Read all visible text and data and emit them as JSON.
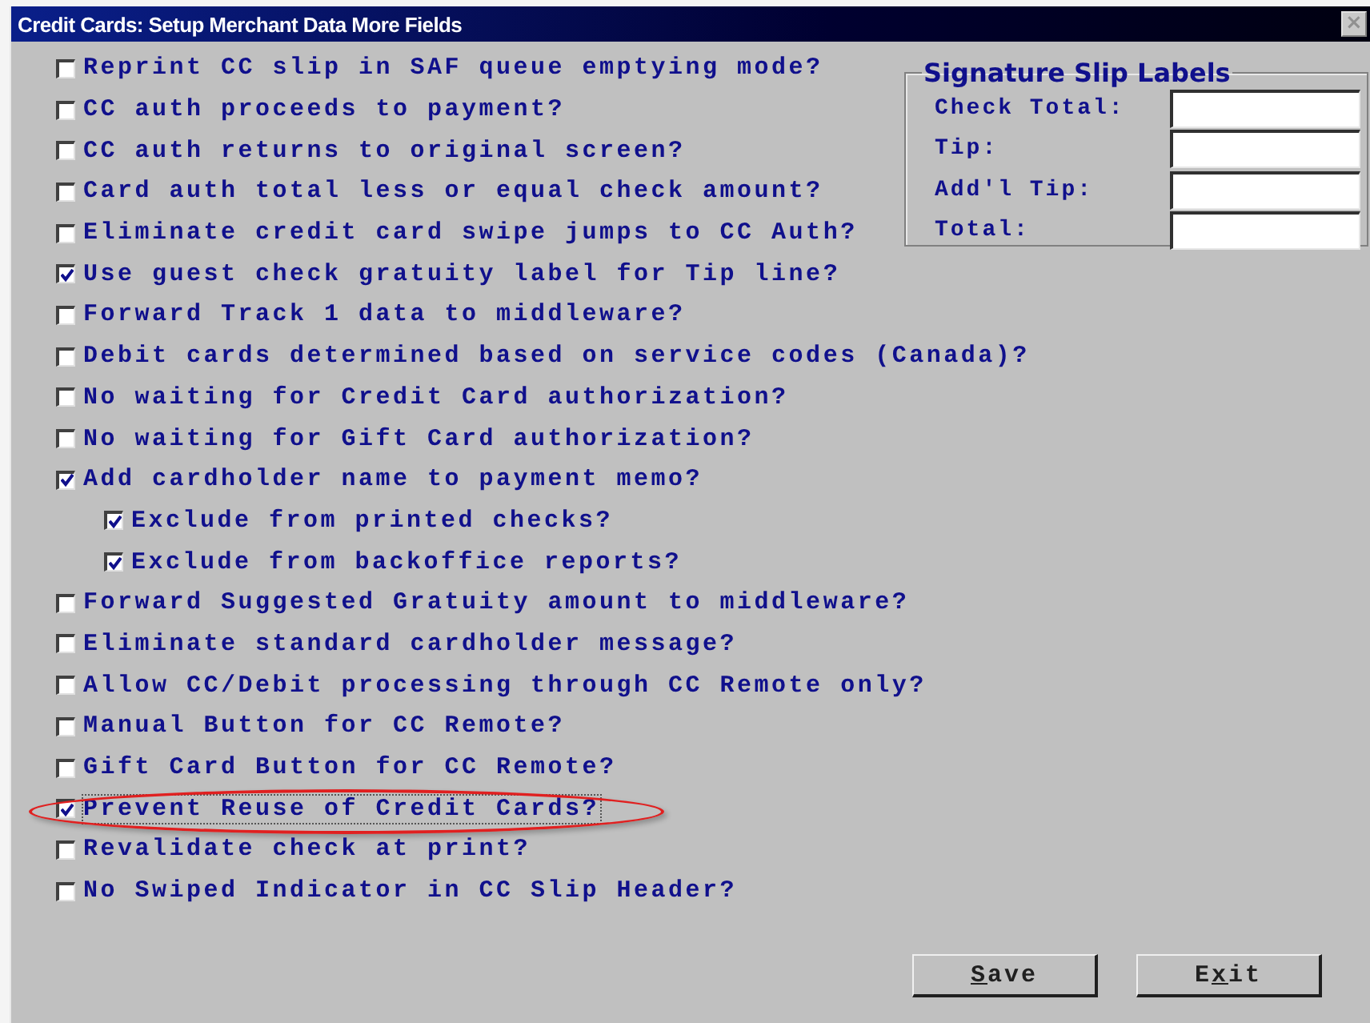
{
  "window": {
    "title": "Credit Cards: Setup Merchant Data More Fields",
    "close_symbol": "×"
  },
  "options": [
    {
      "label": "Reprint CC slip in SAF queue emptying mode?",
      "checked": false
    },
    {
      "label": "CC auth proceeds to payment?",
      "checked": false
    },
    {
      "label": "CC auth returns to original screen?",
      "checked": false
    },
    {
      "label": "Card auth total less or equal check amount?",
      "checked": false
    },
    {
      "label": "Eliminate credit card swipe jumps to CC Auth?",
      "checked": false
    },
    {
      "label": "Use guest check gratuity label for Tip line?",
      "checked": true
    },
    {
      "label": "Forward Track 1 data to middleware?",
      "checked": false
    },
    {
      "label": "Debit cards determined based on service codes (Canada)?",
      "checked": false
    },
    {
      "label": "No waiting for Credit Card authorization?",
      "checked": false
    },
    {
      "label": "No waiting for Gift Card authorization?",
      "checked": false
    },
    {
      "label": "Add cardholder name to payment memo?",
      "checked": true,
      "children": [
        {
          "label": "Exclude from printed checks?",
          "checked": true
        },
        {
          "label": "Exclude from backoffice reports?",
          "checked": true
        }
      ]
    },
    {
      "label": "Forward Suggested Gratuity amount to middleware?",
      "checked": false
    },
    {
      "label": "Eliminate standard cardholder message?",
      "checked": false
    },
    {
      "label": "Allow CC/Debit processing through CC Remote only?",
      "checked": false
    },
    {
      "label": "Manual Button for CC Remote?",
      "checked": false
    },
    {
      "label": "Gift Card Button for CC Remote?",
      "checked": false
    },
    {
      "label": "Prevent Reuse of Credit Cards?",
      "checked": true,
      "focused": true,
      "circled": true
    },
    {
      "label": "Revalidate check at print?",
      "checked": false
    },
    {
      "label": "No Swiped Indicator in CC Slip Header?",
      "checked": false
    }
  ],
  "signature_slip_labels": {
    "title": "Signature Slip Labels",
    "fields": [
      {
        "label": "Check Total:"
      },
      {
        "label": "Tip:"
      },
      {
        "label": "Add'l Tip:"
      },
      {
        "label": "Total:"
      }
    ]
  },
  "buttons": [
    {
      "label_parts": [
        {
          "text": "S",
          "underlined": true
        },
        {
          "text": "ave",
          "underlined": false
        }
      ]
    },
    {
      "label_parts": [
        {
          "text": "E",
          "underlined": false
        },
        {
          "text": "x",
          "underlined": true
        },
        {
          "text": "it",
          "underlined": false
        }
      ]
    }
  ]
}
